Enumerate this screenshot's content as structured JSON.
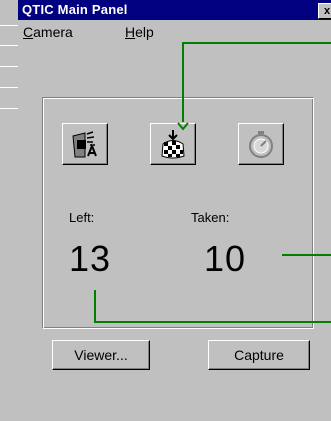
{
  "window": {
    "title": "QTIC  Main Panel",
    "close_symbol": "x"
  },
  "menu": {
    "camera": {
      "underline": "C",
      "rest": "amera"
    },
    "help": {
      "underline": "H",
      "rest": "elp"
    }
  },
  "toolbar": {
    "buttons": [
      {
        "name": "camera-settings",
        "icon": "camera-settings-icon"
      },
      {
        "name": "capture-download",
        "icon": "download-checker-icon"
      },
      {
        "name": "timer",
        "icon": "stopwatch-icon",
        "state": "disabled"
      }
    ]
  },
  "counts": {
    "left_label": "Left:",
    "left_value": "13",
    "taken_label": "Taken:",
    "taken_value": "10"
  },
  "buttons": {
    "viewer": "Viewer...",
    "capture": "Capture"
  },
  "colors": {
    "titlebar": "#000080",
    "face": "#c0c0c0",
    "callout": "#008000"
  }
}
